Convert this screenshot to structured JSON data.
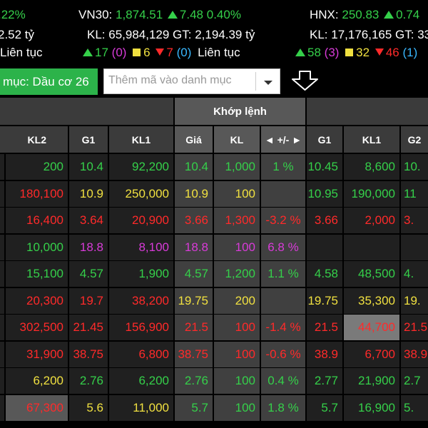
{
  "ticker": {
    "vnindex": {
      "pct": ".22%",
      "gt": "2.52 tỷ",
      "status": "Liên tục"
    },
    "vn30": {
      "name": "VN30:",
      "value": "1,874.51",
      "change": "7.48",
      "pct": "0.40%",
      "volume": "KL: 65,984,129 GT: 2,194.39 tỷ",
      "up": "17",
      "ref": "(0)",
      "same": "6",
      "down": "7",
      "ceiling": "(0)",
      "status": "Liên tục"
    },
    "hnx": {
      "name": "HNX:",
      "value": "250.83",
      "change": "0.74",
      "volume": "KL: 17,176,165 GT: 33",
      "up": "58",
      "ref": "(3)",
      "same": "32",
      "down": "46",
      "ceiling": "(1)"
    }
  },
  "toolbar": {
    "watchlist_tab": "mục: Dầu cơ 26",
    "add_placeholder": "Thêm mã vào danh mục",
    "dropdown_icon": "chevron-down-icon",
    "download_icon": "download-arrow-icon"
  },
  "table": {
    "group_header": "Khớp lệnh",
    "columns": [
      "KL2",
      "G1",
      "KL1",
      "Giá",
      "KL",
      "◄ +/- ►",
      "G1",
      "KL1",
      "G2"
    ],
    "rows": [
      {
        "cells": [
          {
            "v": "200",
            "c": "#35d04a"
          },
          {
            "v": "10.4",
            "c": "#35d04a"
          },
          {
            "v": "92,200",
            "c": "#35d04a"
          },
          {
            "v": "10.4",
            "c": "#35d04a"
          },
          {
            "v": "1,000",
            "c": "#35d04a"
          },
          {
            "v": "1 %",
            "c": "#35d04a"
          },
          {
            "v": "10.45",
            "c": "#35d04a"
          },
          {
            "v": "8,600",
            "c": "#35d04a"
          },
          {
            "v": "10.",
            "c": "#35d04a"
          }
        ]
      },
      {
        "cells": [
          {
            "v": "180,100",
            "c": "#ff2a2a"
          },
          {
            "v": "10.9",
            "c": "#f0e040"
          },
          {
            "v": "250,000",
            "c": "#f0e040"
          },
          {
            "v": "10.9",
            "c": "#f0e040"
          },
          {
            "v": "100",
            "c": "#f0e040"
          },
          {
            "v": "",
            "c": "#f0e040"
          },
          {
            "v": "10.95",
            "c": "#35d04a"
          },
          {
            "v": "190,000",
            "c": "#35d04a"
          },
          {
            "v": "11",
            "c": "#35d04a"
          }
        ]
      },
      {
        "cells": [
          {
            "v": "16,400",
            "c": "#ff2a2a"
          },
          {
            "v": "3.64",
            "c": "#ff2a2a"
          },
          {
            "v": "20,900",
            "c": "#ff2a2a"
          },
          {
            "v": "3.66",
            "c": "#ff2a2a"
          },
          {
            "v": "1,300",
            "c": "#ff2a2a"
          },
          {
            "v": "-3.2 %",
            "c": "#ff2a2a"
          },
          {
            "v": "3.66",
            "c": "#ff2a2a"
          },
          {
            "v": "2,000",
            "c": "#ff2a2a"
          },
          {
            "v": "3.",
            "c": "#ff2a2a"
          }
        ]
      },
      {
        "cells": [
          {
            "v": "10,000",
            "c": "#35d04a"
          },
          {
            "v": "18.8",
            "c": "#d83bd8"
          },
          {
            "v": "8,100",
            "c": "#d83bd8"
          },
          {
            "v": "18.8",
            "c": "#d83bd8"
          },
          {
            "v": "100",
            "c": "#d83bd8"
          },
          {
            "v": "6.8 %",
            "c": "#d83bd8"
          },
          {
            "v": "",
            "c": "#fff"
          },
          {
            "v": "",
            "c": "#fff"
          },
          {
            "v": "",
            "c": "#fff"
          }
        ]
      },
      {
        "cells": [
          {
            "v": "15,100",
            "c": "#35d04a"
          },
          {
            "v": "4.57",
            "c": "#35d04a"
          },
          {
            "v": "1,900",
            "c": "#35d04a"
          },
          {
            "v": "4.57",
            "c": "#35d04a"
          },
          {
            "v": "1,200",
            "c": "#35d04a"
          },
          {
            "v": "1.1 %",
            "c": "#35d04a"
          },
          {
            "v": "4.58",
            "c": "#35d04a"
          },
          {
            "v": "48,500",
            "c": "#35d04a"
          },
          {
            "v": "4.",
            "c": "#35d04a"
          }
        ]
      },
      {
        "cells": [
          {
            "v": "20,300",
            "c": "#ff2a2a"
          },
          {
            "v": "19.7",
            "c": "#ff2a2a"
          },
          {
            "v": "38,200",
            "c": "#ff2a2a"
          },
          {
            "v": "19.75",
            "c": "#f0e040"
          },
          {
            "v": "200",
            "c": "#f0e040"
          },
          {
            "v": "",
            "c": "#f0e040"
          },
          {
            "v": "19.75",
            "c": "#f0e040"
          },
          {
            "v": "35,300",
            "c": "#f0e040"
          },
          {
            "v": "19.",
            "c": "#f0e040"
          }
        ]
      },
      {
        "cells": [
          {
            "v": "302,500",
            "c": "#ff2a2a"
          },
          {
            "v": "21.45",
            "c": "#ff2a2a"
          },
          {
            "v": "156,900",
            "c": "#ff2a2a"
          },
          {
            "v": "21.5",
            "c": "#ff2a2a"
          },
          {
            "v": "100",
            "c": "#ff2a2a"
          },
          {
            "v": "-1.4 %",
            "c": "#ff2a2a"
          },
          {
            "v": "21.5",
            "c": "#ff2a2a"
          },
          {
            "v": "44,700",
            "c": "#ff2a2a"
          },
          {
            "v": "21.5",
            "c": "#ff2a2a"
          }
        ]
      },
      {
        "cells": [
          {
            "v": "31,900",
            "c": "#ff2a2a"
          },
          {
            "v": "38.75",
            "c": "#ff2a2a"
          },
          {
            "v": "6,800",
            "c": "#ff2a2a"
          },
          {
            "v": "38.75",
            "c": "#ff2a2a"
          },
          {
            "v": "100",
            "c": "#ff2a2a"
          },
          {
            "v": "-0.6 %",
            "c": "#ff2a2a"
          },
          {
            "v": "38.9",
            "c": "#ff2a2a"
          },
          {
            "v": "6,700",
            "c": "#ff2a2a"
          },
          {
            "v": "38.9",
            "c": "#ff2a2a"
          }
        ]
      },
      {
        "cells": [
          {
            "v": "6,200",
            "c": "#f0e040"
          },
          {
            "v": "2.76",
            "c": "#35d04a"
          },
          {
            "v": "6,200",
            "c": "#35d04a"
          },
          {
            "v": "2.76",
            "c": "#35d04a"
          },
          {
            "v": "100",
            "c": "#35d04a"
          },
          {
            "v": "0.4 %",
            "c": "#35d04a"
          },
          {
            "v": "2.77",
            "c": "#35d04a"
          },
          {
            "v": "21,900",
            "c": "#35d04a"
          },
          {
            "v": "2.7",
            "c": "#35d04a"
          }
        ]
      },
      {
        "cells": [
          {
            "v": "67,300",
            "c": "#ff2a2a"
          },
          {
            "v": "5.6",
            "c": "#f0e040"
          },
          {
            "v": "11,000",
            "c": "#f0e040"
          },
          {
            "v": "5.7",
            "c": "#35d04a"
          },
          {
            "v": "100",
            "c": "#35d04a"
          },
          {
            "v": "1.8 %",
            "c": "#35d04a"
          },
          {
            "v": "5.7",
            "c": "#35d04a"
          },
          {
            "v": "16,900",
            "c": "#35d04a"
          },
          {
            "v": "5.",
            "c": "#35d04a"
          }
        ]
      }
    ]
  },
  "colors": {
    "up": "#35d04a",
    "ref": "#f0e040",
    "down": "#ff2a2a",
    "ceiling": "#d83bd8",
    "floor": "#39b8ff",
    "highlight_cell": "#7a7a7a"
  }
}
